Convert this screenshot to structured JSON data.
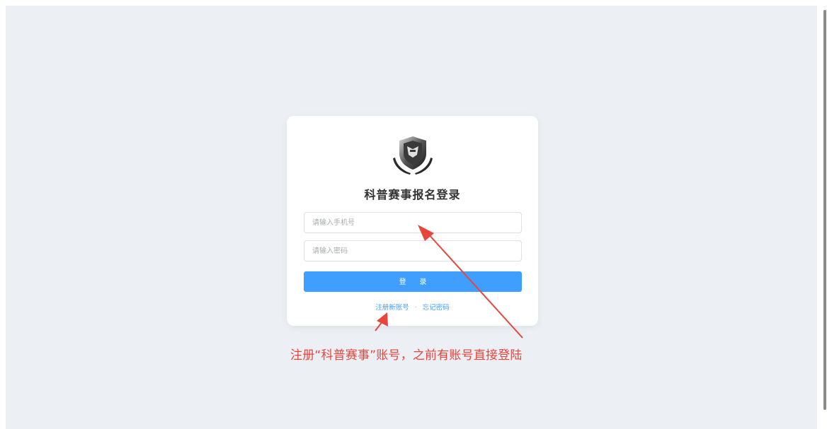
{
  "login": {
    "title": "科普赛事报名登录",
    "phone_placeholder": "请输入手机号",
    "password_placeholder": "请输入密码",
    "submit_label": "登 录",
    "register_link": "注册新账号",
    "separator": "·",
    "forgot_link": "忘记密码",
    "logo_icon": "shield-hands-logo-icon"
  },
  "annotation": {
    "text": "注册“科普赛事”账号，之前有账号直接登陆",
    "color": "#e8453c"
  },
  "theme": {
    "background": "#eceff4",
    "accent": "#409eff",
    "annotation_color": "#e8453c"
  }
}
